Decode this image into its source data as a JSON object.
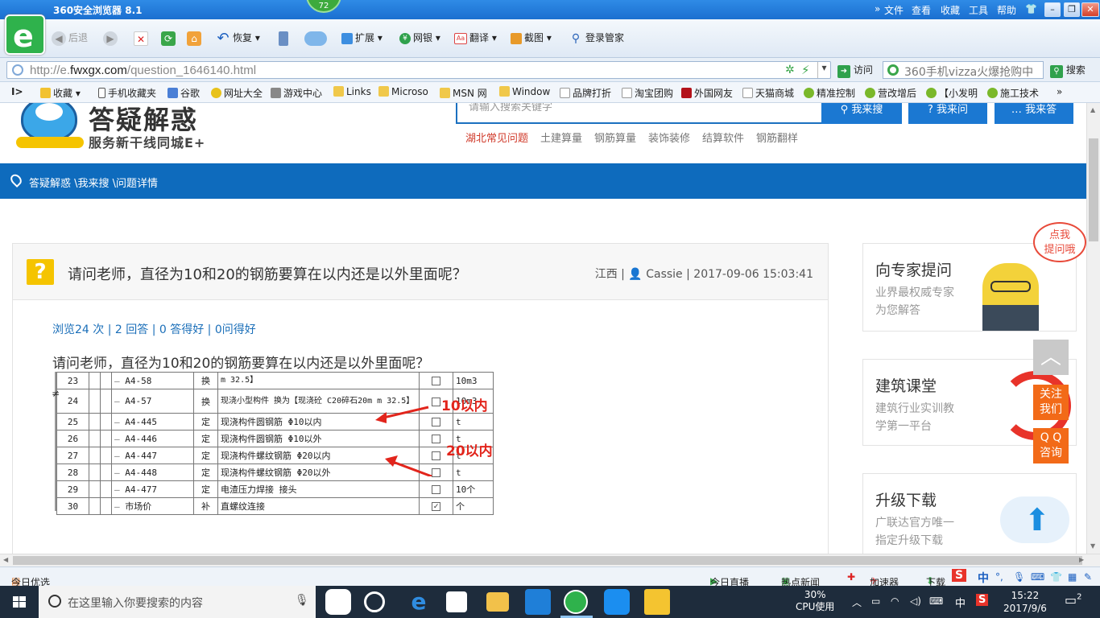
{
  "browser": {
    "title": "360安全浏览器 8.1",
    "badge": "72",
    "menu": [
      "文件",
      "查看",
      "收藏",
      "工具",
      "帮助"
    ],
    "toolbar": {
      "back": "后退",
      "restore": "恢复",
      "extensions": "扩展",
      "netbank": "网银",
      "translate": "翻译",
      "screenshot": "截图",
      "login_manager": "登录管家"
    },
    "address": {
      "url_prefix": "http://e.",
      "url_domain": "fwxgx.com",
      "url_path": "/question_1646140.html",
      "visit": "访问",
      "search_value": "360手机vizza火爆抢购中",
      "search_button": "搜索"
    },
    "bookmarks": [
      "收藏",
      "手机收藏夹",
      "谷歌",
      "网址大全",
      "游戏中心",
      "Links",
      "Microso",
      "MSN 网",
      "Window",
      "品牌打折",
      "淘宝团购",
      "外国网友",
      "天猫商城",
      "精准控制",
      "营改增后",
      "【小发明",
      "施工技术"
    ]
  },
  "site": {
    "logo_title": "答疑解惑",
    "logo_subtitle": "服务新干线同城E+",
    "search_placeholder": "请输入搜索关键字",
    "buttons": [
      "我来搜",
      "我来问",
      "我来答"
    ],
    "hotlinks": [
      "湖北常见问题",
      "土建算量",
      "钢筋算量",
      "装饰装修",
      "结算软件",
      "钢筋翻样"
    ],
    "breadcrumb": "答疑解惑 \\我来搜 \\问题详情"
  },
  "question": {
    "icon": "?",
    "title": "请问老师，直径为10和20的钢筋要算在以内还是以外里面呢？",
    "region": "江西",
    "user": "Cassie",
    "datetime": "2017-09-06 15:03:41",
    "stats": "浏览24 次 | 2 回答 | 0 答得好 | 0问得好",
    "body": "请问老师，直径为10和20的钢筋要算在以内还是以外里面呢？",
    "annotations": [
      "10以内",
      "20以内"
    ],
    "sheet_rows": [
      {
        "no": "23",
        "code": "A4-58",
        "type": "换",
        "desc": "m 32.5】",
        "checked": false,
        "unit": "10m3"
      },
      {
        "no": "24",
        "code": "A4-57",
        "type": "换",
        "desc": "现浇小型构件  换为【现浇砼 C20碎石20m m 32.5】",
        "checked": false,
        "unit": "10m3"
      },
      {
        "no": "25",
        "code": "A4-445",
        "type": "定",
        "desc": "现浇构件圆钢筋 Φ10以内",
        "checked": false,
        "unit": "t"
      },
      {
        "no": "26",
        "code": "A4-446",
        "type": "定",
        "desc": "现浇构件圆钢筋 Φ10以外",
        "checked": false,
        "unit": "t"
      },
      {
        "no": "27",
        "code": "A4-447",
        "type": "定",
        "desc": "现浇构件螺纹钢筋 Φ20以内",
        "checked": false,
        "unit": "t"
      },
      {
        "no": "28",
        "code": "A4-448",
        "type": "定",
        "desc": "现浇构件螺纹钢筋 Φ20以外",
        "checked": false,
        "unit": "t"
      },
      {
        "no": "29",
        "code": "A4-477",
        "type": "定",
        "desc": "电渣压力焊接 接头",
        "checked": false,
        "unit": "10个"
      },
      {
        "no": "30",
        "code": "市场价",
        "type": "补",
        "desc": "直螺纹连接",
        "checked": true,
        "unit": "个"
      }
    ]
  },
  "sidebar": {
    "ask_expert": {
      "title": "向专家提问",
      "desc1": "业界最权威专家",
      "desc2": "为您解答",
      "bubble1": "点我",
      "bubble2": "提问哦"
    },
    "classroom": {
      "title": "建筑课堂",
      "desc1": "建筑行业实训教",
      "desc2": "学第一平台"
    },
    "upgrade": {
      "title": "升级下载",
      "desc1": "广联达官方唯一",
      "desc2": "指定升级下载"
    },
    "follow": [
      "关注",
      "我们"
    ],
    "qq": [
      "Q Q",
      "咨询"
    ]
  },
  "statusbar": {
    "left": "今日优选",
    "live": "今日直播",
    "news": "热点新闻",
    "accelerator": "加速器",
    "download": "下载",
    "ime": "中"
  },
  "taskbar": {
    "search_placeholder": "在这里输入你要搜索的内容",
    "cpu_percent": "30%",
    "cpu_label": "CPU使用",
    "ime": "中",
    "time": "15:22",
    "date": "2017/9/6",
    "notifications": "2"
  },
  "colors": {
    "accent": "#0e6bbd",
    "question_icon": "#f5c400",
    "annotation": "#e2251c",
    "float_btn": "#f26a18"
  }
}
